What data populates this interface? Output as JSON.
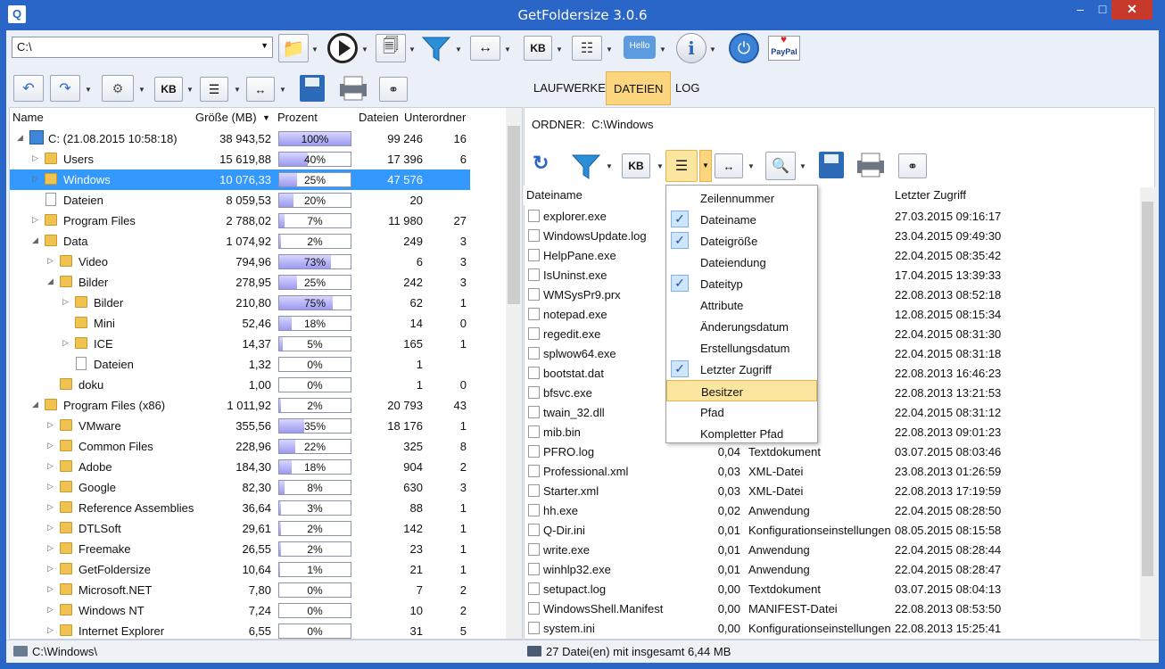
{
  "app": {
    "title": "GetFoldersize 3.0.6"
  },
  "window": {
    "minimize": "–",
    "maximize": "□",
    "close": "✕"
  },
  "toolbar": {
    "drive_value": "C:\\",
    "paypal_label": "PayPal",
    "hello_label": "Hello",
    "kb_label": "KB"
  },
  "tabs": [
    {
      "label": "LAUFWERKE",
      "selected": false
    },
    {
      "label": "DATEIEN",
      "selected": true
    },
    {
      "label": "LOG",
      "selected": false
    }
  ],
  "left_columns": {
    "name": "Name",
    "size": "Größe (MB)",
    "percent": "Prozent",
    "files": "Dateien",
    "subfolders": "Unterordner"
  },
  "tree": [
    {
      "indent": 0,
      "twisty": "◢",
      "icon": "pc",
      "name": "C: (21.08.2015 10:58:18)",
      "size": "38 943,52",
      "pct": 100,
      "pct_label": "100%",
      "files": "99 246",
      "sub": "16"
    },
    {
      "indent": 1,
      "twisty": "▷",
      "icon": "folder",
      "name": "Users",
      "size": "15 619,88",
      "pct": 40,
      "pct_label": "40%",
      "files": "17 396",
      "sub": "6"
    },
    {
      "indent": 1,
      "twisty": "▷",
      "icon": "folder",
      "name": "Windows",
      "size": "10 076,33",
      "pct": 25,
      "pct_label": "25%",
      "files": "47 576",
      "sub": "",
      "selected": true
    },
    {
      "indent": 1,
      "twisty": "",
      "icon": "doc",
      "name": "Dateien",
      "size": "8 059,53",
      "pct": 20,
      "pct_label": "20%",
      "files": "20",
      "sub": ""
    },
    {
      "indent": 1,
      "twisty": "▷",
      "icon": "folder",
      "name": "Program Files",
      "size": "2 788,02",
      "pct": 7,
      "pct_label": "7%",
      "files": "11 980",
      "sub": "27"
    },
    {
      "indent": 1,
      "twisty": "◢",
      "icon": "folder",
      "name": "Data",
      "size": "1 074,92",
      "pct": 2,
      "pct_label": "2%",
      "files": "249",
      "sub": "3"
    },
    {
      "indent": 2,
      "twisty": "▷",
      "icon": "folder",
      "name": "Video",
      "size": "794,96",
      "pct": 73,
      "pct_label": "73%",
      "files": "6",
      "sub": "3"
    },
    {
      "indent": 2,
      "twisty": "◢",
      "icon": "folder",
      "name": "Bilder",
      "size": "278,95",
      "pct": 25,
      "pct_label": "25%",
      "files": "242",
      "sub": "3"
    },
    {
      "indent": 3,
      "twisty": "▷",
      "icon": "folder",
      "name": "Bilder",
      "size": "210,80",
      "pct": 75,
      "pct_label": "75%",
      "files": "62",
      "sub": "1"
    },
    {
      "indent": 3,
      "twisty": "",
      "icon": "folder",
      "name": "Mini",
      "size": "52,46",
      "pct": 18,
      "pct_label": "18%",
      "files": "14",
      "sub": "0"
    },
    {
      "indent": 3,
      "twisty": "▷",
      "icon": "folder",
      "name": "ICE",
      "size": "14,37",
      "pct": 5,
      "pct_label": "5%",
      "files": "165",
      "sub": "1"
    },
    {
      "indent": 3,
      "twisty": "",
      "icon": "doc",
      "name": "Dateien",
      "size": "1,32",
      "pct": 0,
      "pct_label": "0%",
      "files": "1",
      "sub": ""
    },
    {
      "indent": 2,
      "twisty": "",
      "icon": "folder",
      "name": "doku",
      "size": "1,00",
      "pct": 0,
      "pct_label": "0%",
      "files": "1",
      "sub": "0"
    },
    {
      "indent": 1,
      "twisty": "◢",
      "icon": "folder",
      "name": "Program Files (x86)",
      "size": "1 011,92",
      "pct": 2,
      "pct_label": "2%",
      "files": "20 793",
      "sub": "43"
    },
    {
      "indent": 2,
      "twisty": "▷",
      "icon": "folder",
      "name": "VMware",
      "size": "355,56",
      "pct": 35,
      "pct_label": "35%",
      "files": "18 176",
      "sub": "1"
    },
    {
      "indent": 2,
      "twisty": "▷",
      "icon": "folder",
      "name": "Common Files",
      "size": "228,96",
      "pct": 22,
      "pct_label": "22%",
      "files": "325",
      "sub": "8"
    },
    {
      "indent": 2,
      "twisty": "▷",
      "icon": "folder",
      "name": "Adobe",
      "size": "184,30",
      "pct": 18,
      "pct_label": "18%",
      "files": "904",
      "sub": "2"
    },
    {
      "indent": 2,
      "twisty": "▷",
      "icon": "folder",
      "name": "Google",
      "size": "82,30",
      "pct": 8,
      "pct_label": "8%",
      "files": "630",
      "sub": "3"
    },
    {
      "indent": 2,
      "twisty": "▷",
      "icon": "folder",
      "name": "Reference Assemblies",
      "size": "36,64",
      "pct": 3,
      "pct_label": "3%",
      "files": "88",
      "sub": "1"
    },
    {
      "indent": 2,
      "twisty": "▷",
      "icon": "folder",
      "name": "DTLSoft",
      "size": "29,61",
      "pct": 2,
      "pct_label": "2%",
      "files": "142",
      "sub": "1"
    },
    {
      "indent": 2,
      "twisty": "▷",
      "icon": "folder",
      "name": "Freemake",
      "size": "26,55",
      "pct": 2,
      "pct_label": "2%",
      "files": "23",
      "sub": "1"
    },
    {
      "indent": 2,
      "twisty": "▷",
      "icon": "folder",
      "name": "GetFoldersize",
      "size": "10,64",
      "pct": 1,
      "pct_label": "1%",
      "files": "21",
      "sub": "1"
    },
    {
      "indent": 2,
      "twisty": "▷",
      "icon": "folder",
      "name": "Microsoft.NET",
      "size": "7,80",
      "pct": 0,
      "pct_label": "0%",
      "files": "7",
      "sub": "2"
    },
    {
      "indent": 2,
      "twisty": "▷",
      "icon": "folder",
      "name": "Windows NT",
      "size": "7,24",
      "pct": 0,
      "pct_label": "0%",
      "files": "10",
      "sub": "2"
    },
    {
      "indent": 2,
      "twisty": "▷",
      "icon": "folder",
      "name": "Internet Explorer",
      "size": "6,55",
      "pct": 0,
      "pct_label": "0%",
      "files": "31",
      "sub": "5"
    }
  ],
  "right": {
    "ordner_label": "ORDNER:",
    "ordner_path": "C:\\Windows",
    "columns": {
      "name": "Dateiname",
      "accessed": "Letzter Zugriff"
    }
  },
  "files": [
    {
      "name": "explorer.exe",
      "size": "",
      "type": "",
      "date": "27.03.2015 09:16:17"
    },
    {
      "name": "WindowsUpdate.log",
      "size": "",
      "type": "nt",
      "date": "23.04.2015 09:49:30"
    },
    {
      "name": "HelpPane.exe",
      "size": "",
      "type": "",
      "date": "22.04.2015 08:35:42"
    },
    {
      "name": "IsUninst.exe",
      "size": "",
      "type": "",
      "date": "17.04.2015 13:39:33"
    },
    {
      "name": "WMSysPr9.prx",
      "size": "",
      "type": "",
      "date": "22.08.2013 08:52:18"
    },
    {
      "name": "notepad.exe",
      "size": "",
      "type": "",
      "date": "12.08.2015 08:15:34"
    },
    {
      "name": "regedit.exe",
      "size": "",
      "type": "",
      "date": "22.04.2015 08:31:30"
    },
    {
      "name": "splwow64.exe",
      "size": "",
      "type": "",
      "date": "22.04.2015 08:31:18"
    },
    {
      "name": "bootstat.dat",
      "size": "",
      "type": "",
      "date": "22.08.2013 16:46:23"
    },
    {
      "name": "bfsvc.exe",
      "size": "",
      "type": "",
      "date": "22.08.2013 13:21:53"
    },
    {
      "name": "twain_32.dll",
      "size": "",
      "type": "erweiterung",
      "date": "22.04.2015 08:31:12"
    },
    {
      "name": "mib.bin",
      "size": "",
      "type": "",
      "date": "22.08.2013 09:01:23"
    },
    {
      "name": "PFRO.log",
      "size": "0,04",
      "type": "Textdokument",
      "date": "03.07.2015 08:03:46"
    },
    {
      "name": "Professional.xml",
      "size": "0,03",
      "type": "XML-Datei",
      "date": "23.08.2013 01:26:59"
    },
    {
      "name": "Starter.xml",
      "size": "0,03",
      "type": "XML-Datei",
      "date": "22.08.2013 17:19:59"
    },
    {
      "name": "hh.exe",
      "size": "0,02",
      "type": "Anwendung",
      "date": "22.04.2015 08:28:50"
    },
    {
      "name": "Q-Dir.ini",
      "size": "0,01",
      "type": "Konfigurationseinstellungen",
      "date": "08.05.2015 08:15:58"
    },
    {
      "name": "write.exe",
      "size": "0,01",
      "type": "Anwendung",
      "date": "22.04.2015 08:28:44"
    },
    {
      "name": "winhlp32.exe",
      "size": "0,01",
      "type": "Anwendung",
      "date": "22.04.2015 08:28:47"
    },
    {
      "name": "setupact.log",
      "size": "0,00",
      "type": "Textdokument",
      "date": "03.07.2015 08:04:13"
    },
    {
      "name": "WindowsShell.Manifest",
      "size": "0,00",
      "type": "MANIFEST-Datei",
      "date": "22.08.2013 08:53:50"
    },
    {
      "name": "system.ini",
      "size": "0,00",
      "type": "Konfigurationseinstellungen",
      "date": "22.08.2013 15:25:41"
    }
  ],
  "column_menu": [
    {
      "label": "Zeilennummer",
      "checked": false
    },
    {
      "label": "Dateiname",
      "checked": true
    },
    {
      "label": "Dateigröße",
      "checked": true
    },
    {
      "label": "Dateiendung",
      "checked": false
    },
    {
      "label": "Dateityp",
      "checked": true
    },
    {
      "label": "Attribute",
      "checked": false
    },
    {
      "label": "Änderungsdatum",
      "checked": false
    },
    {
      "label": "Erstellungsdatum",
      "checked": false
    },
    {
      "label": "Letzter Zugriff",
      "checked": true
    },
    {
      "label": "Besitzer",
      "checked": false,
      "highlighted": true
    },
    {
      "label": "Pfad",
      "checked": false
    },
    {
      "label": "Kompletter Pfad",
      "checked": false
    }
  ],
  "status": {
    "left": "C:\\Windows\\",
    "right": "27 Datei(en) mit insgesamt 6,44 MB"
  },
  "colors": {
    "titlebar": "#2a65c8",
    "selection": "#3399ff",
    "tab_selected": "#fcd67e",
    "bar_fill": "#9c9af0"
  }
}
